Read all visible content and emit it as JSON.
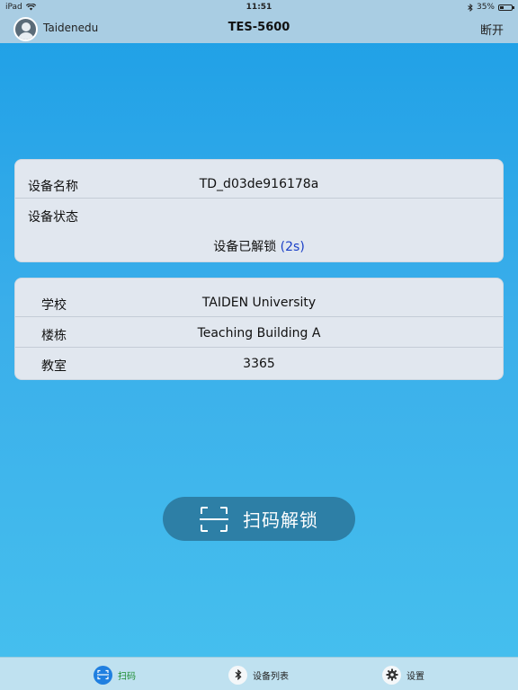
{
  "status_bar": {
    "device": "iPad",
    "time": "11:51",
    "battery_percent": 35,
    "battery_label": "35%"
  },
  "nav": {
    "username": "Taidenedu",
    "title": "TES-5600",
    "disconnect_label": "断开"
  },
  "device_card": {
    "name_label": "设备名称",
    "name_value": "TD_d03de916178a",
    "status_label": "设备状态",
    "status_text": "设备已解锁",
    "countdown": "(2s)"
  },
  "location_card": {
    "rows": [
      {
        "label": "学校",
        "value": "TAIDEN University"
      },
      {
        "label": "楼栋",
        "value": "Teaching Building A"
      },
      {
        "label": "教室",
        "value": "3365"
      }
    ]
  },
  "scan_button": {
    "label": "扫码解锁"
  },
  "tab_bar": {
    "tabs": [
      {
        "label": "扫码",
        "icon": "scan-icon",
        "active": true
      },
      {
        "label": "设备列表",
        "icon": "bluetooth-icon",
        "active": false
      },
      {
        "label": "设置",
        "icon": "gear-icon",
        "active": false
      }
    ]
  },
  "colors": {
    "accent": "#1f7fe0",
    "active_tab_text": "#1c8c2f",
    "countdown_text": "#1a3fc7",
    "scan_button_bg": "#2d7fa6"
  }
}
